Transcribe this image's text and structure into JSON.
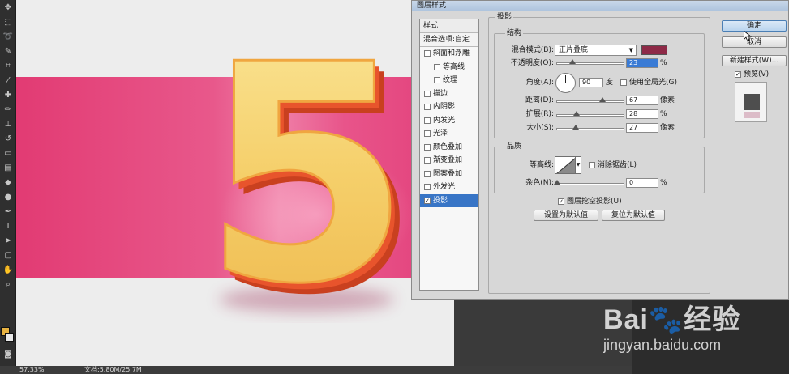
{
  "dialog": {
    "title": "图层样式",
    "buttons": {
      "ok": "确定",
      "cancel": "取消",
      "new_style": "新建样式(W)...",
      "preview": "预览(V)"
    },
    "preview_checked": true
  },
  "styles_panel": {
    "header": "样式",
    "blending": "混合选项:自定",
    "items": [
      {
        "label": "斜面和浮雕",
        "checked": false,
        "sub": false
      },
      {
        "label": "等高线",
        "checked": false,
        "sub": true
      },
      {
        "label": "纹理",
        "checked": false,
        "sub": true
      },
      {
        "label": "描边",
        "checked": false,
        "sub": false
      },
      {
        "label": "内阴影",
        "checked": false,
        "sub": false
      },
      {
        "label": "内发光",
        "checked": false,
        "sub": false
      },
      {
        "label": "光泽",
        "checked": false,
        "sub": false
      },
      {
        "label": "颜色叠加",
        "checked": false,
        "sub": false
      },
      {
        "label": "渐变叠加",
        "checked": false,
        "sub": false
      },
      {
        "label": "图案叠加",
        "checked": false,
        "sub": false
      },
      {
        "label": "外发光",
        "checked": false,
        "sub": false
      },
      {
        "label": "投影",
        "checked": true,
        "sub": false,
        "selected": true
      }
    ]
  },
  "shadow": {
    "title": "投影",
    "structure": {
      "title": "结构",
      "blend_mode_label": "混合模式(B):",
      "blend_mode_value": "正片叠底",
      "shadow_color": "#8e2a47",
      "opacity_label": "不透明度(O):",
      "opacity_value": "23",
      "angle_label": "角度(A):",
      "angle_value": "90",
      "angle_unit": "度",
      "global_light_label": "使用全局光(G)",
      "global_light_checked": false,
      "distance_label": "距离(D):",
      "distance_value": "67",
      "spread_label": "扩展(R):",
      "spread_value": "28",
      "size_label": "大小(S):",
      "size_value": "27",
      "unit_px": "像素",
      "unit_pct": "%"
    },
    "quality": {
      "title": "品质",
      "contour_label": "等高线:",
      "anti_alias_label": "消除锯齿(L)",
      "anti_alias_checked": false,
      "noise_label": "杂色(N):",
      "noise_value": "0"
    },
    "knockout_label": "图层挖空投影(U)",
    "knockout_checked": true,
    "make_default": "设置为默认值",
    "reset_default": "复位为默认值"
  },
  "canvas": {
    "digit": "5",
    "band_color": "#e8508a",
    "digit_face_color": "#f5cf6a",
    "digit_edge_color": "#e8542c"
  },
  "status_bar": {
    "zoom": "57.33%",
    "doc_info": "文档:5.80M/25.7M"
  },
  "watermark": {
    "logo": "Bai🐾经验",
    "url": "jingyan.baidu.com"
  },
  "check_mark": "✓"
}
